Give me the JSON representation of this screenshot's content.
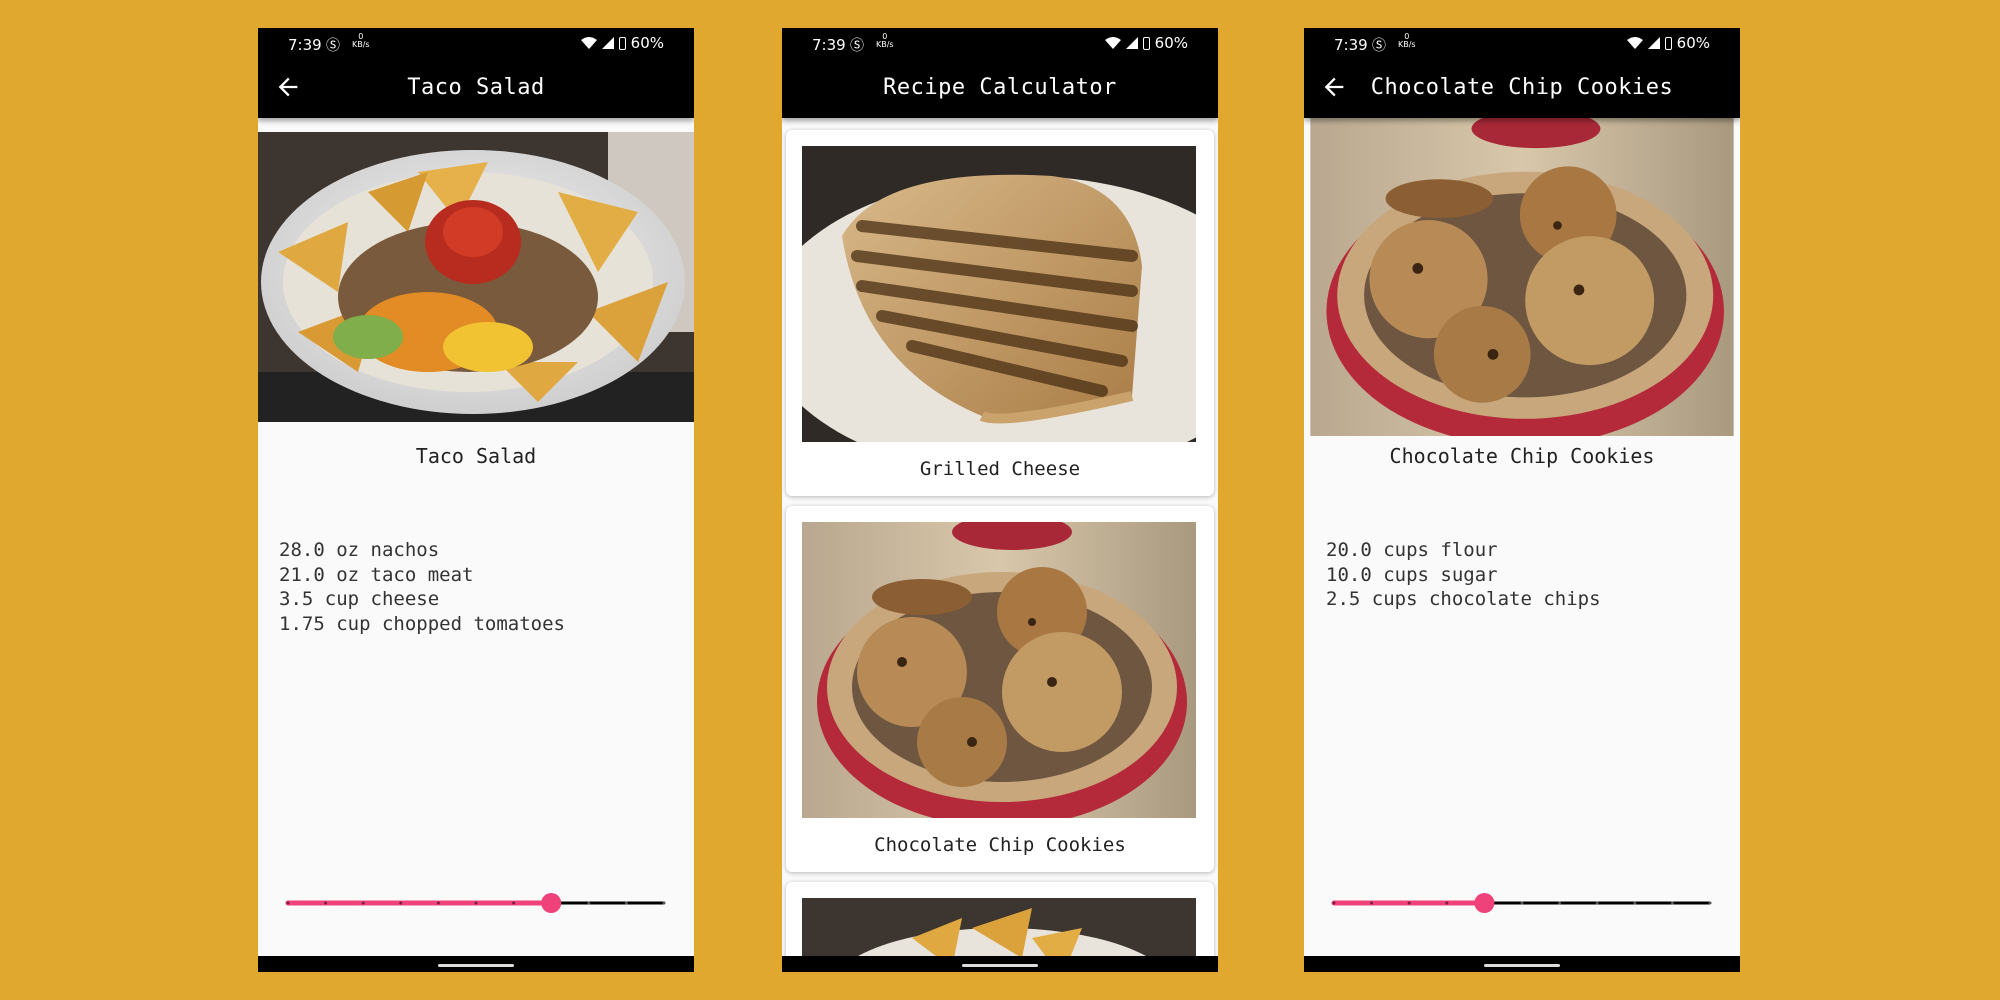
{
  "statusbar": {
    "time": "7:39",
    "speed_value": "0",
    "speed_unit": "KB/s",
    "battery": "60%"
  },
  "screens": [
    {
      "appbar_title": "Taco Salad",
      "detail_title": "Taco Salad",
      "ingredients": [
        "28.0 oz nachos",
        "21.0 oz taco meat",
        "3.5 cup cheese",
        "1.75 cup chopped tomatoes"
      ],
      "slider": {
        "steps": 10,
        "value_step": 7
      }
    },
    {
      "appbar_title": "Recipe Calculator",
      "cards": [
        {
          "title": "Grilled Cheese",
          "image": "grilled-cheese-photo"
        },
        {
          "title": "Chocolate Chip Cookies",
          "image": "cookies-photo"
        },
        {
          "title": "",
          "image": "taco-salad-photo"
        }
      ]
    },
    {
      "appbar_title": "Chocolate Chip Cookies",
      "detail_title": "Chocolate Chip Cookies",
      "ingredients": [
        "20.0 cups flour",
        "10.0 cups sugar",
        "2.5 cups chocolate chips"
      ],
      "slider": {
        "steps": 10,
        "value_step": 4
      }
    }
  ],
  "colors": {
    "background": "#E0A82E",
    "app_bar": "#000000",
    "slider_active": "#F0427A",
    "slider_inactive": "#000000",
    "screen_bg": "#FAFAFA"
  },
  "icons": {
    "back": "arrow-left-icon",
    "wifi": "wifi-icon",
    "signal": "signal-icon",
    "battery": "battery-icon"
  }
}
